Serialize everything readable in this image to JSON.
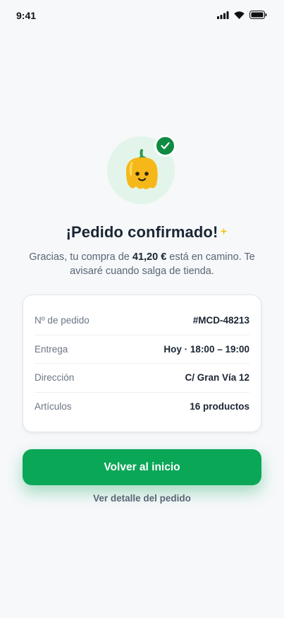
{
  "status_bar": {
    "time": "9:41"
  },
  "hero": {
    "icon": "pepper-mascot",
    "badge_icon": "check-icon"
  },
  "title": "¡Pedido confirmado!",
  "subtitle": {
    "prefix": "Gracias, tu compra de ",
    "amount": "41,20 €",
    "suffix": " está en camino. Te avisaré cuando salga de tienda."
  },
  "order_details": [
    {
      "label": "Nº de pedido",
      "value": "#MCD-48213"
    },
    {
      "label": "Entrega",
      "value": "Hoy · 18:00 – 19:00"
    },
    {
      "label": "Dirección",
      "value": "C/ Gran Vía 12"
    },
    {
      "label": "Artículos",
      "value": "16 productos"
    }
  ],
  "primary_button": "Volver al inicio",
  "secondary_link": "Ver detalle del pedido",
  "colors": {
    "accent": "#0aa757",
    "badge": "#0e8a43",
    "hero_bg": "#e3f5ea",
    "pepper": "#f6b819",
    "sparkle": "#f5c518"
  }
}
